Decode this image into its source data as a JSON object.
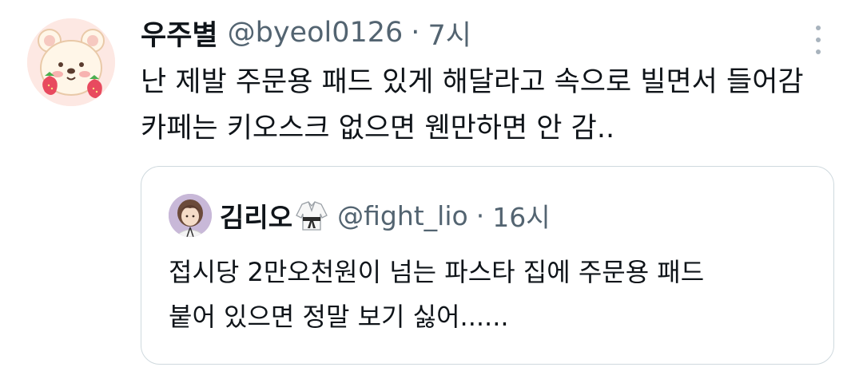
{
  "tweet": {
    "display_name": "우주별",
    "handle": "@byeol0126",
    "separator": "·",
    "time": "7시",
    "lines": [
      "난 제발 주문용 패드 있게 해달라고 속으로 빌면서 들어감",
      "카페는 키오스크 없으면 웬만하면 안 감.."
    ],
    "avatar_icon": "bear-with-strawberries-avatar",
    "more_icon": "more-vertical-icon"
  },
  "quoted_tweet": {
    "display_name": "김리오",
    "name_emoji_icon": "martial-arts-uniform-icon",
    "handle": "@fight_lio",
    "separator": "·",
    "time": "16시",
    "lines": [
      "접시당 2만오천원이 넘는 파스타 집에 주문용 패드",
      "붙어 있으면 정말 보기 싫어......"
    ],
    "avatar_icon": "illustrated-person-avatar"
  },
  "colors": {
    "text_primary": "#0f1419",
    "text_secondary": "#536471",
    "border": "#cfd9de",
    "background": "#ffffff"
  }
}
